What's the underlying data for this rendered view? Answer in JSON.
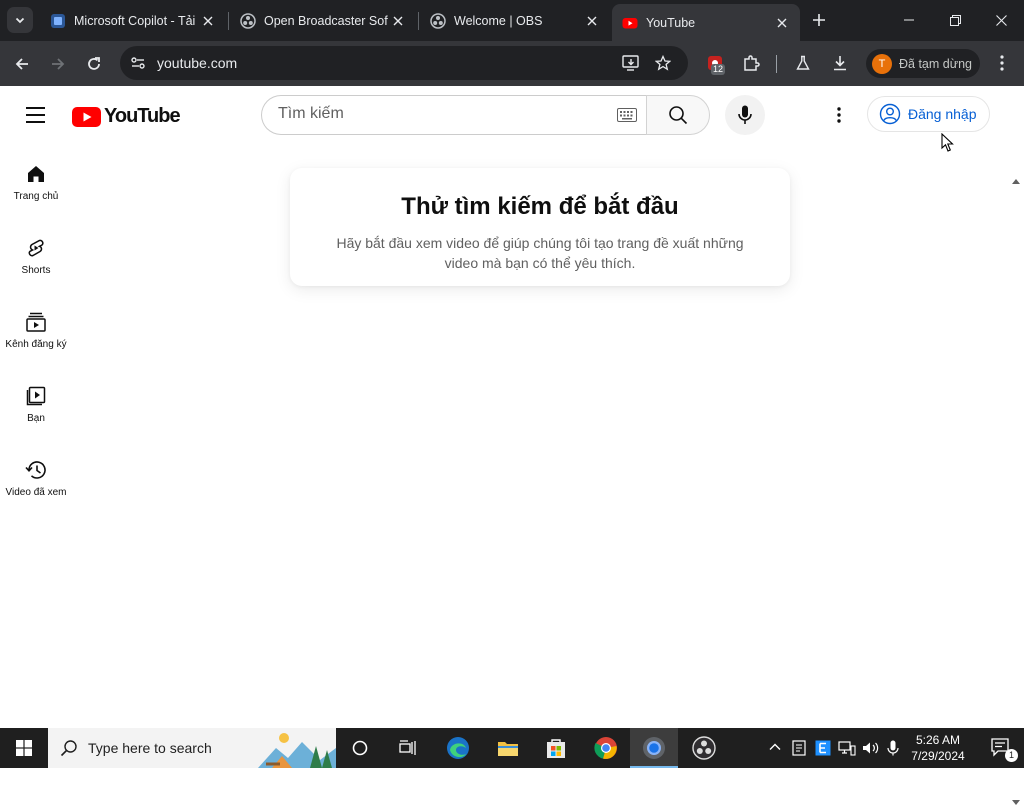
{
  "browser": {
    "tabs": [
      {
        "title": "Microsoft Copilot - Tải",
        "favicon": "copilot-icon"
      },
      {
        "title": "Open Broadcaster Softw",
        "favicon": "obs-icon"
      },
      {
        "title": "Welcome | OBS",
        "favicon": "obs-icon"
      },
      {
        "title": "YouTube",
        "favicon": "youtube-icon",
        "active": true
      }
    ],
    "url": "youtube.com",
    "extension_badge": "12",
    "profile": {
      "initial": "T",
      "label": "Đã tạm dừng",
      "color": "#e8710a"
    }
  },
  "youtube": {
    "logo_text": "YouTube",
    "search": {
      "placeholder": "Tìm kiếm"
    },
    "signin_label": "Đăng nhập",
    "guide": [
      {
        "label": "Trang chủ",
        "icon": "home-icon"
      },
      {
        "label": "Shorts",
        "icon": "shorts-icon"
      },
      {
        "label": "Kênh đăng ký",
        "icon": "subscriptions-icon"
      },
      {
        "label": "Bạn",
        "icon": "you-icon"
      },
      {
        "label": "Video đã xem",
        "icon": "history-icon"
      }
    ],
    "promo": {
      "title": "Thử tìm kiếm để bắt đầu",
      "description": "Hãy bắt đầu xem video để giúp chúng tôi tạo trang đề xuất những video mà bạn có thể yêu thích."
    },
    "brand_color": "#ff0000",
    "link_color": "#065fd4"
  },
  "taskbar": {
    "search_placeholder": "Type here to search",
    "time": "5:26 AM",
    "date": "7/29/2024",
    "notification_count": "1"
  }
}
